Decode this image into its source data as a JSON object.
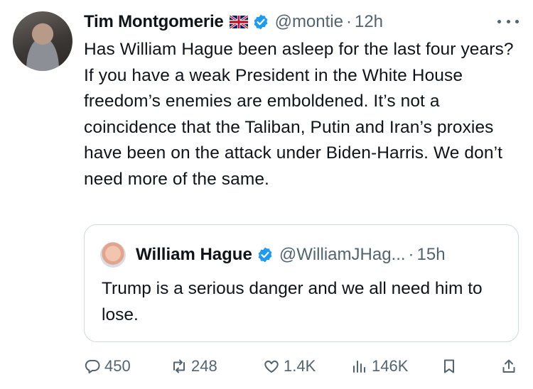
{
  "tweet": {
    "author_name": "Tim Montgomerie",
    "handle": "@montie",
    "separator": "·",
    "time": "12h",
    "text": "Has William Hague been asleep for the last four years? If you have a weak President in the White House freedom’s enemies are emboldened. It’s not a coincidence that the Taliban, Putin and Iran’s proxies have been on the attack under Biden-Harris. We don’t need more of the same."
  },
  "quote": {
    "author_name": "William Hague",
    "handle": "@WilliamJHag...",
    "separator": "·",
    "time": "15h",
    "text": "Trump is a serious danger and we all need him to lose."
  },
  "actions": {
    "replies": "450",
    "reposts": "248",
    "likes": "1.4K",
    "views": "146K"
  },
  "colors": {
    "text": "#0f1419",
    "secondary": "#536471",
    "verified": "#1d9bf0",
    "border": "#cfd9de"
  },
  "icons": [
    "uk-flag-icon",
    "verified-badge-icon",
    "more-options-icon",
    "reply-icon",
    "repost-icon",
    "like-icon",
    "views-icon",
    "bookmark-icon",
    "share-icon"
  ]
}
